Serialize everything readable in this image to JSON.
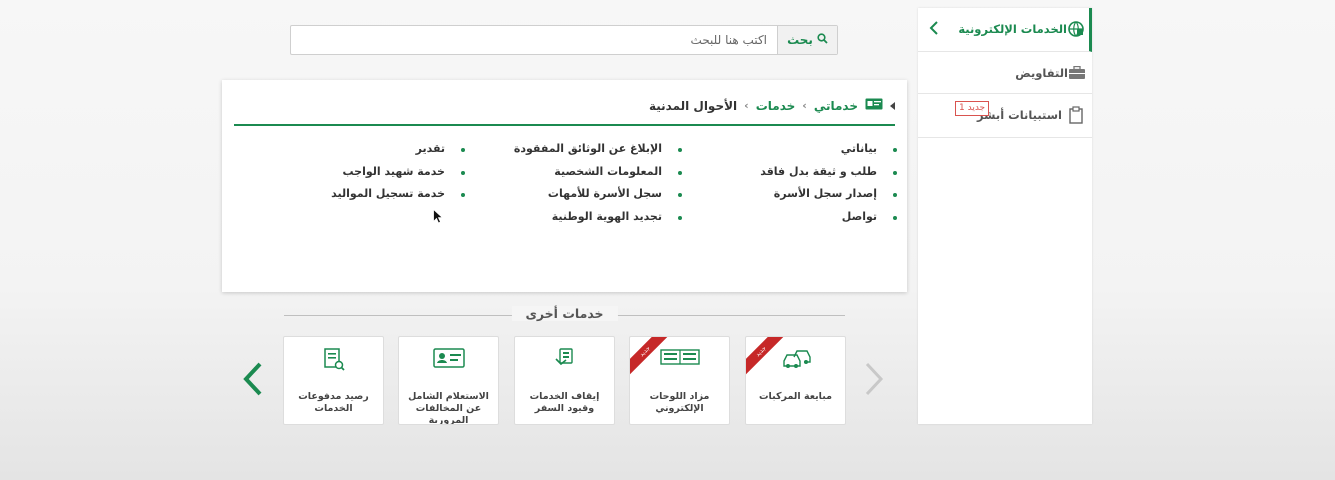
{
  "sidebar": {
    "header": "الخدمات الإلكترونية",
    "items": [
      {
        "label": "التفاويض"
      },
      {
        "label": "استبيانات أبشر",
        "badge": "جديد 1"
      }
    ]
  },
  "search": {
    "button_label": "بحث",
    "placeholder": "اكتب هنا للبحث"
  },
  "breadcrumb": {
    "items": [
      "خدماتي",
      "خدمات",
      "الأحوال المدنية"
    ]
  },
  "services": {
    "col1": [
      "بياناتي",
      "طلب و ثيقة بدل فاقد",
      "إصدار سجل الأسرة",
      "تواصل"
    ],
    "col2": [
      "الإبلاغ عن الوثائق المفقودة",
      "المعلومات الشخصية",
      "سجل الأسرة للأمهات",
      "تجديد الهوية الوطنية"
    ],
    "col3": [
      "تقدير",
      "خدمة شهيد الواجب",
      "خدمة تسجيل المواليد"
    ]
  },
  "other_services": {
    "title": "خدمات أخرى",
    "cards": [
      {
        "label": "مبايعة المركبات",
        "ribbon": "جديد",
        "icon": "cars-icon"
      },
      {
        "label": "مزاد اللوحات الإلكتروني",
        "ribbon": "جديد",
        "icon": "plates-icon"
      },
      {
        "label": "إيقاف الخدمات وقيود السفر",
        "icon": "suspend-icon"
      },
      {
        "label": "الاستعلام الشامل عن المخالفات المرورية",
        "icon": "id-card-icon"
      },
      {
        "label": "رصيد مدفوعات الخدمات",
        "icon": "receipt-search-icon"
      }
    ]
  },
  "colors": {
    "accent": "#1b8a50",
    "badge": "#d9534f",
    "ribbon": "#c62828"
  }
}
